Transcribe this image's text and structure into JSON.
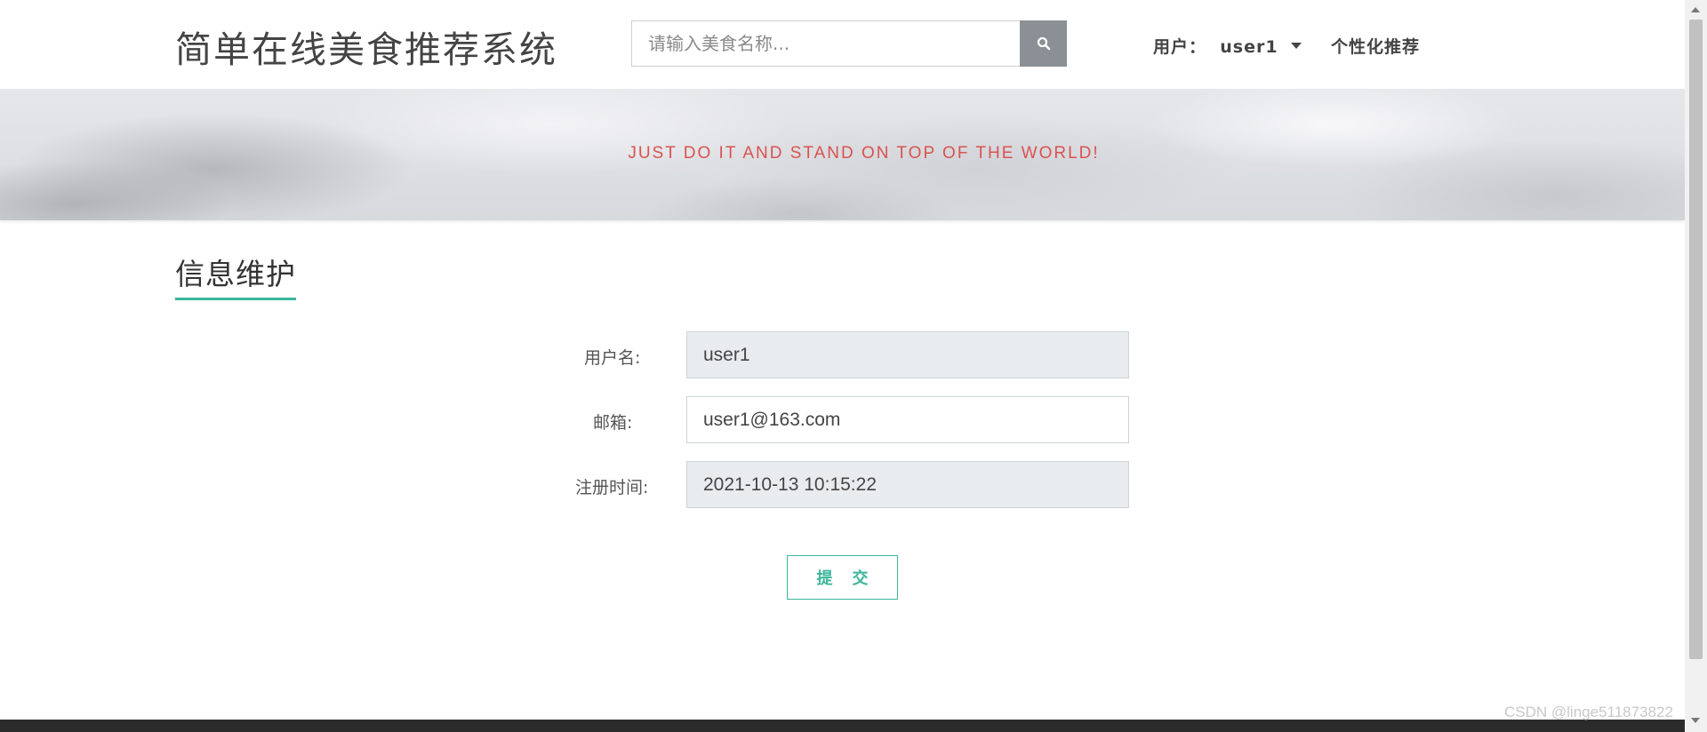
{
  "header": {
    "site_title": "简单在线美食推荐系统",
    "search": {
      "placeholder": "请输入美食名称..."
    },
    "user_menu_label": "用户：  user1",
    "recommend_link": "个性化推荐"
  },
  "banner": {
    "slogan": "JUST DO IT AND STAND ON TOP OF THE WORLD!"
  },
  "section": {
    "title": "信息维护"
  },
  "form": {
    "username": {
      "label": "用户名:",
      "value": "user1"
    },
    "email": {
      "label": "邮箱:",
      "value": "user1@163.com"
    },
    "register_time": {
      "label": "注册时间:",
      "value": "2021-10-13 10:15:22"
    },
    "submit_label": "提交"
  },
  "watermark": "CSDN @linge511873822",
  "colors": {
    "accent": "#3ab59a",
    "slogan": "#d9534f",
    "search_button": "#8a9096",
    "readonly_field": "#e9ecef",
    "footer": "#2b2b2b"
  },
  "icons": {
    "search_button": "search-icon",
    "user_dropdown": "caret-down-icon"
  }
}
